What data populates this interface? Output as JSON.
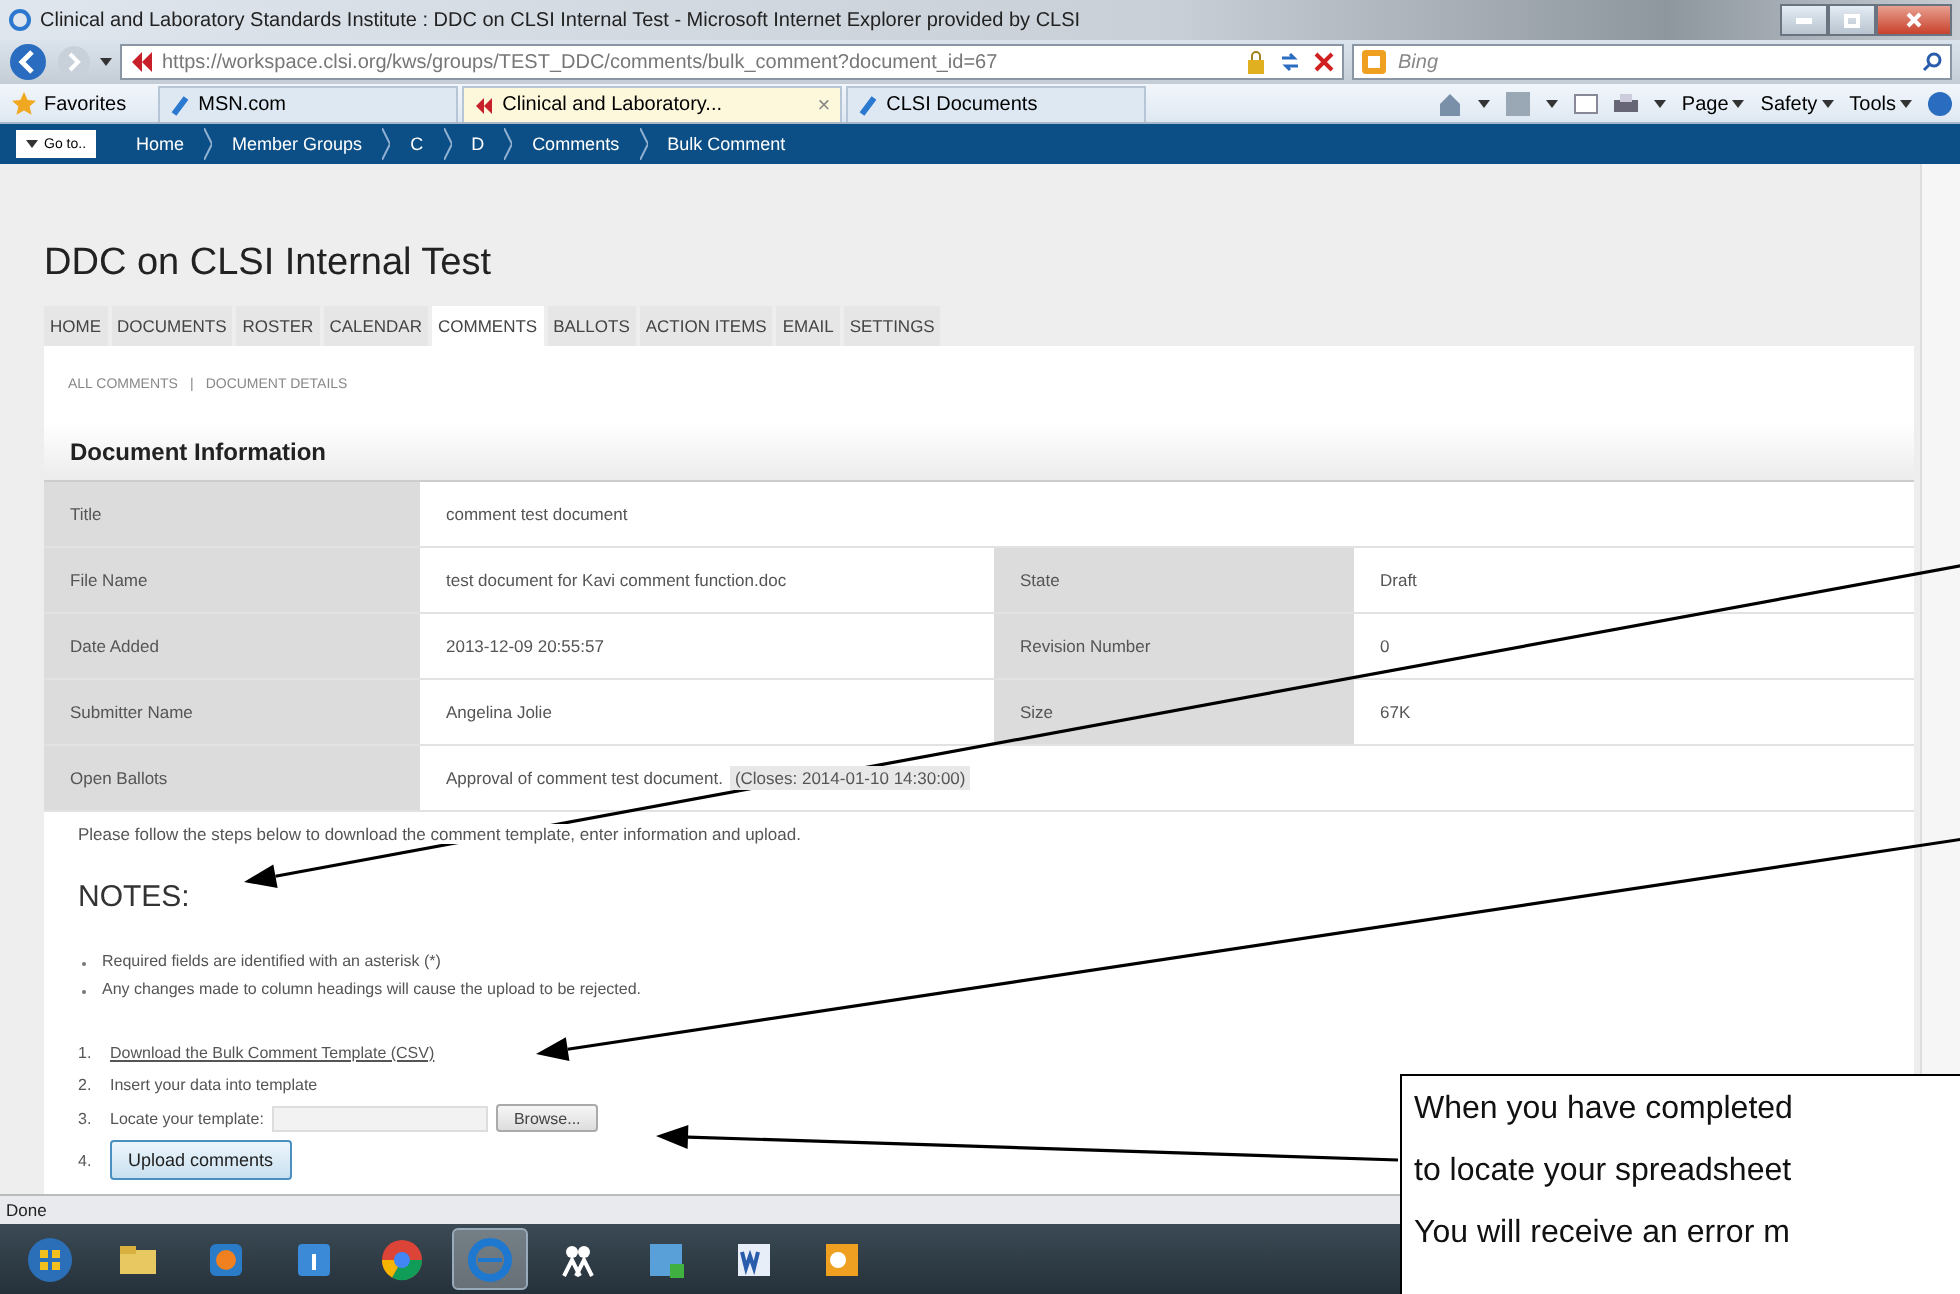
{
  "window": {
    "title": "Clinical and Laboratory Standards Institute : DDC on CLSI Internal Test - Microsoft Internet Explorer provided by CLSI",
    "url": "https://workspace.clsi.org/kws/groups/TEST_DDC/comments/bulk_comment?document_id=67",
    "search_placeholder": "Bing"
  },
  "favorites": "Favorites",
  "browser_tabs": [
    {
      "label": "MSN.com",
      "selected": false
    },
    {
      "label": "Clinical and Laboratory...",
      "selected": true,
      "close": "×"
    },
    {
      "label": "CLSI Documents",
      "selected": false
    }
  ],
  "command_bar": [
    "Page",
    "Safety",
    "Tools"
  ],
  "nav": {
    "goto": "Go to..",
    "breadcrumbs": [
      "Home",
      "Member Groups",
      "C",
      "D",
      "Comments",
      "Bulk Comment"
    ]
  },
  "page": {
    "heading": "DDC on CLSI Internal Test",
    "tabs": [
      {
        "label": "HOME",
        "selected": false
      },
      {
        "label": "DOCUMENTS",
        "selected": false
      },
      {
        "label": "ROSTER",
        "selected": false
      },
      {
        "label": "CALENDAR",
        "selected": false
      },
      {
        "label": "COMMENTS",
        "selected": true
      },
      {
        "label": "BALLOTS",
        "selected": false
      },
      {
        "label": "ACTION ITEMS",
        "selected": false
      },
      {
        "label": "EMAIL",
        "selected": false
      },
      {
        "label": "SETTINGS",
        "selected": false
      }
    ],
    "subnav": [
      "ALL COMMENTS",
      "DOCUMENT DETAILS"
    ],
    "subnav_separator": "|",
    "section_title": "Document Information",
    "rows": [
      {
        "cells": [
          {
            "label": "Title",
            "value": "comment test document"
          }
        ]
      },
      {
        "cells": [
          {
            "label": "File Name",
            "value": "test document for Kavi comment function.doc"
          },
          {
            "label": "State",
            "value": "Draft"
          }
        ]
      },
      {
        "cells": [
          {
            "label": "Date Added",
            "value": "2013-12-09 20:55:57"
          },
          {
            "label": "Revision Number",
            "value": "0"
          }
        ]
      },
      {
        "cells": [
          {
            "label": "Submitter Name",
            "value": "Angelina Jolie"
          },
          {
            "label": "Size",
            "value": "67K"
          }
        ]
      },
      {
        "cells": [
          {
            "label": "Open Ballots",
            "value": "Approval of comment test document.",
            "note": "(Closes: 2014-01-10 14:30:00)"
          }
        ]
      }
    ],
    "intro": "Please follow the steps below to download the comment template, enter information and upload.",
    "notes_heading": "NOTES:",
    "notes": [
      "Required fields are identified with an asterisk (*)",
      "Any changes made to column headings will cause the upload to be rejected."
    ],
    "steps": [
      {
        "number": "1.",
        "kind": "link",
        "text": "Download the Bulk Comment Template (CSV)"
      },
      {
        "number": "2.",
        "kind": "text",
        "text": "Insert your data into template"
      },
      {
        "number": "3.",
        "kind": "file",
        "text": "Locate your template:",
        "button": "Browse..."
      },
      {
        "number": "4.",
        "kind": "button",
        "text": "Upload comments"
      }
    ]
  },
  "status_bar": "Done",
  "taskbar": [
    {
      "kind": "start",
      "selected": false
    },
    {
      "kind": "folder",
      "selected": false
    },
    {
      "kind": "media",
      "selected": false
    },
    {
      "kind": "info",
      "selected": false
    },
    {
      "kind": "chrome",
      "selected": false
    },
    {
      "kind": "ie",
      "selected": true
    },
    {
      "kind": "people",
      "selected": false
    },
    {
      "kind": "lync",
      "selected": false
    },
    {
      "kind": "word",
      "selected": false
    },
    {
      "kind": "outlook",
      "selected": false
    }
  ],
  "callout": {
    "lines": [
      "When you have completed",
      "to locate your spreadsheet",
      "You will receive an error m"
    ]
  }
}
